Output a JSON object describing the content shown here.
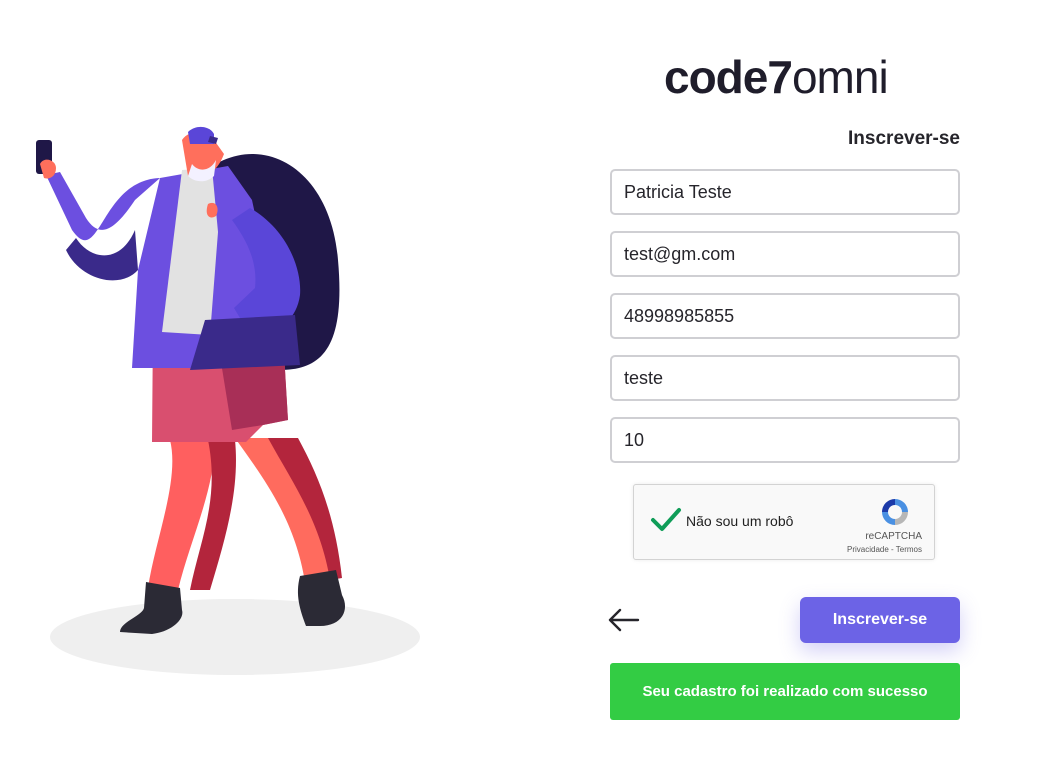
{
  "brand": {
    "logo_bold": "code7",
    "logo_light": "omni"
  },
  "form": {
    "title": "Inscrever-se",
    "fields": [
      {
        "name": "name",
        "value": "Patricia Teste"
      },
      {
        "name": "email",
        "value": "test@gm.com"
      },
      {
        "name": "phone",
        "value": "48998985855"
      },
      {
        "name": "company",
        "value": "teste"
      },
      {
        "name": "employees",
        "value": "10"
      }
    ],
    "recaptcha": {
      "label": "Não sou um robô",
      "brand": "reCAPTCHA",
      "privacy": "Privacidade",
      "separator": " - ",
      "terms": "Termos",
      "checked": true
    },
    "back_icon": "arrow-left-icon",
    "submit_label": "Inscrever-se",
    "success_message": "Seu cadastro foi realizado com sucesso"
  },
  "colors": {
    "primary": "#6c63e6",
    "success": "#33cc44",
    "text": "#26252b",
    "border": "#cfcfd3"
  }
}
